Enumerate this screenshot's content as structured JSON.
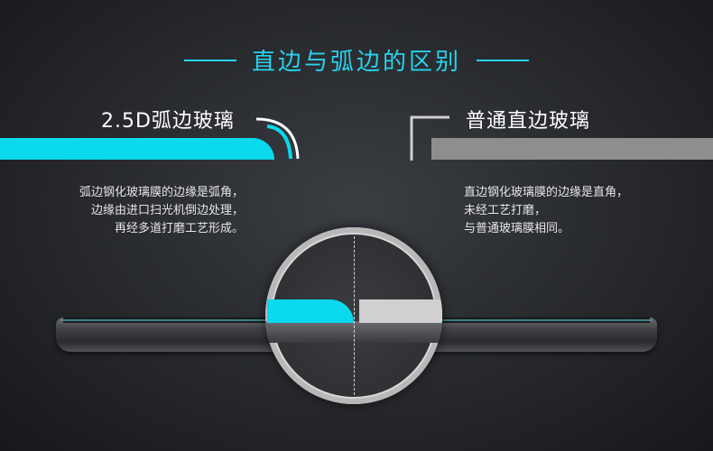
{
  "header": {
    "title": "直边与弧边的区别"
  },
  "left": {
    "label": "2.5D弧边玻璃",
    "desc": [
      "弧边钢化玻璃膜的边缘是弧角，",
      "边缘由进口扫光机倒边处理，",
      "再经多道打磨工艺形成。"
    ]
  },
  "right": {
    "label": "普通直边玻璃",
    "desc": [
      "直边钢化玻璃膜的边缘是直角，",
      "未经工艺打磨，",
      "与普通玻璃膜相同。"
    ]
  },
  "colors": {
    "accent": "#27d3ee",
    "arc_glass": "#0ad9ee",
    "flat_glass": "#8e8e8e",
    "background": "#26282c"
  }
}
